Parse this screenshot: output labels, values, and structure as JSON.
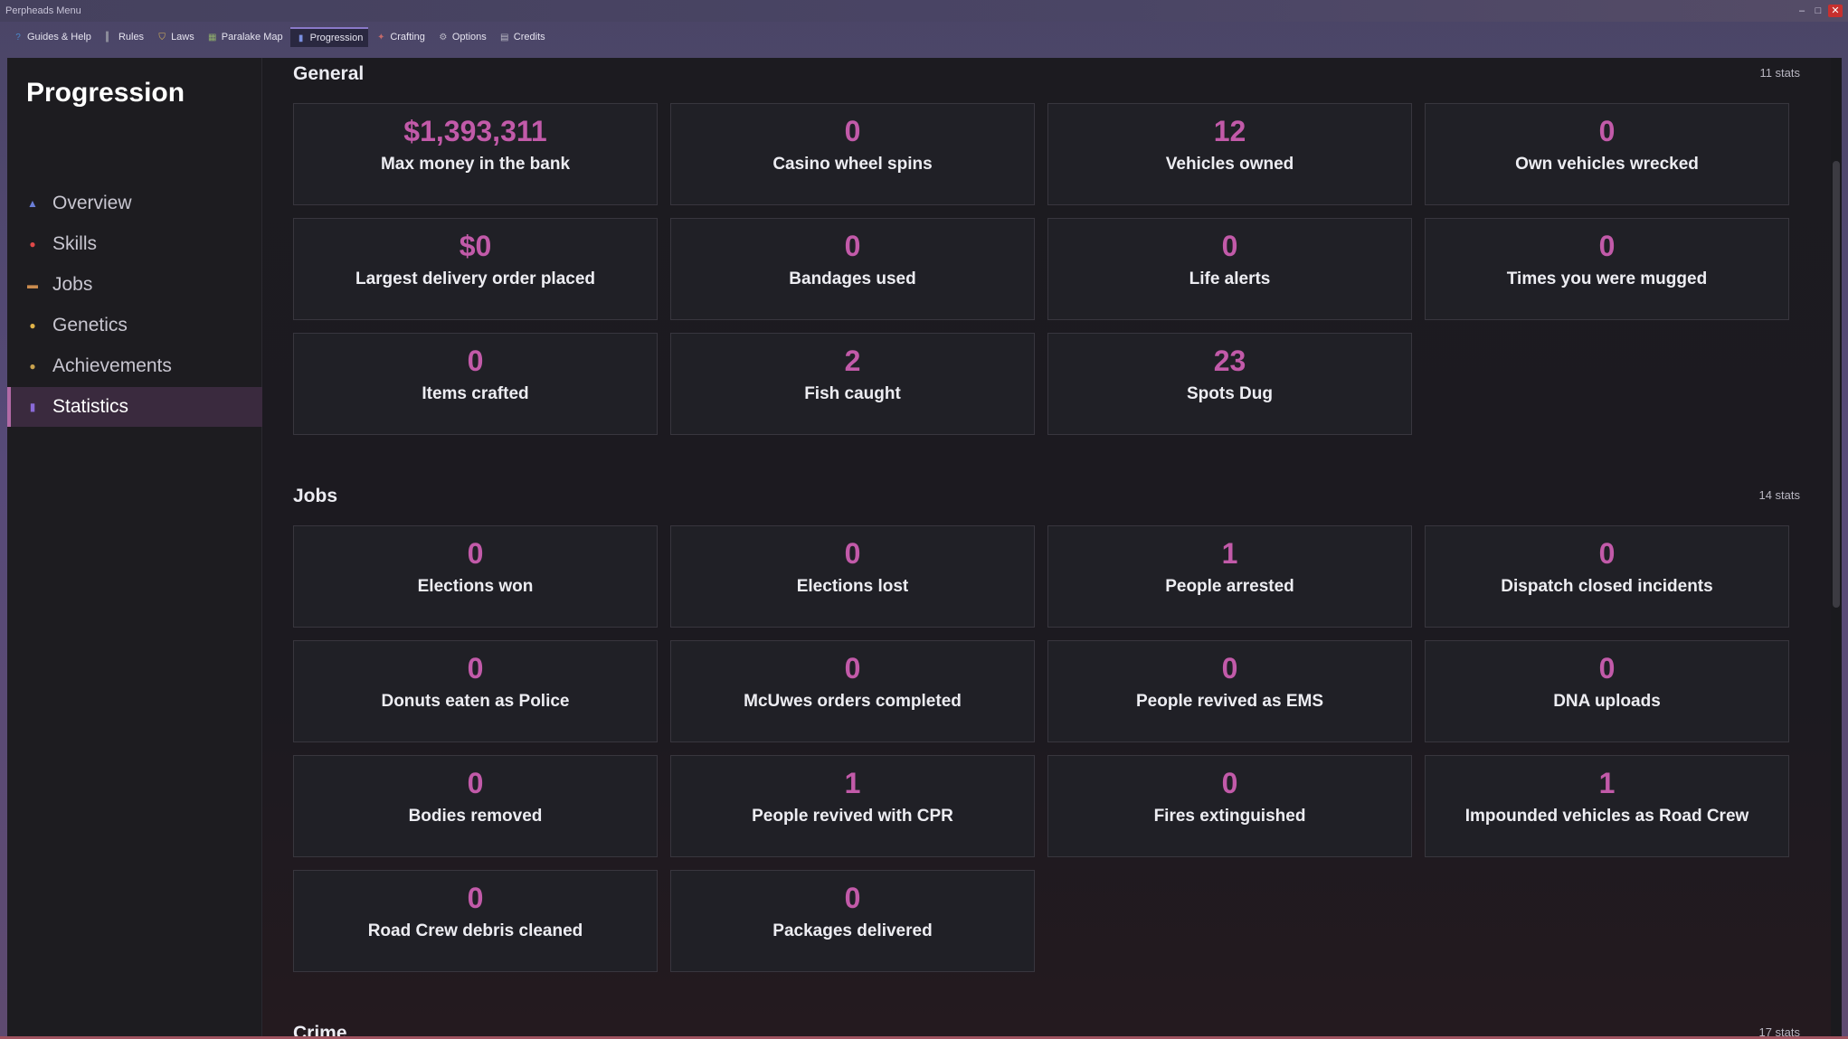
{
  "window": {
    "title": "Perpheads Menu",
    "close_glyph": "✕"
  },
  "menubar": [
    {
      "label": "Guides & Help",
      "icon": "help-icon",
      "glyph": "?",
      "color": "#4a8acc"
    },
    {
      "label": "Rules",
      "icon": "rules-icon",
      "glyph": "▍",
      "color": "#8b8b9a"
    },
    {
      "label": "Laws",
      "icon": "shield-icon",
      "glyph": "⛉",
      "color": "#d9b65a"
    },
    {
      "label": "Paralake Map",
      "icon": "map-icon",
      "glyph": "▦",
      "color": "#8fae6b"
    },
    {
      "label": "Progression",
      "icon": "chart-icon",
      "glyph": "▮",
      "color": "#7a8fe0"
    },
    {
      "label": "Crafting",
      "icon": "crafting-icon",
      "glyph": "✦",
      "color": "#c46a6a"
    },
    {
      "label": "Options",
      "icon": "gear-icon",
      "glyph": "⚙",
      "color": "#b9b9c4"
    },
    {
      "label": "Credits",
      "icon": "credits-icon",
      "glyph": "▤",
      "color": "#b9b9c4"
    }
  ],
  "sidebar": {
    "title": "Progression",
    "items": [
      {
        "label": "Overview",
        "icon": "overview-icon",
        "glyph": "▲",
        "color": "#6a7ed8"
      },
      {
        "label": "Skills",
        "icon": "skills-icon",
        "glyph": "●",
        "color": "#e04848"
      },
      {
        "label": "Jobs",
        "icon": "jobs-icon",
        "glyph": "▬",
        "color": "#c98b4e"
      },
      {
        "label": "Genetics",
        "icon": "genetics-icon",
        "glyph": "●",
        "color": "#e0b348"
      },
      {
        "label": "Achievements",
        "icon": "trophy-icon",
        "glyph": "●",
        "color": "#c9a24e"
      },
      {
        "label": "Statistics",
        "icon": "statistics-icon",
        "glyph": "▮",
        "color": "#8a6ad8"
      }
    ]
  },
  "sections": [
    {
      "title": "General",
      "count": "11 stats",
      "stats": [
        {
          "value": "$1,393,311",
          "label": "Max money in the bank"
        },
        {
          "value": "0",
          "label": "Casino wheel spins"
        },
        {
          "value": "12",
          "label": "Vehicles owned"
        },
        {
          "value": "0",
          "label": "Own vehicles wrecked"
        },
        {
          "value": "$0",
          "label": "Largest delivery order placed"
        },
        {
          "value": "0",
          "label": "Bandages used"
        },
        {
          "value": "0",
          "label": "Life alerts"
        },
        {
          "value": "0",
          "label": "Times you were mugged"
        },
        {
          "value": "0",
          "label": "Items crafted"
        },
        {
          "value": "2",
          "label": "Fish caught"
        },
        {
          "value": "23",
          "label": "Spots Dug"
        }
      ]
    },
    {
      "title": "Jobs",
      "count": "14 stats",
      "stats": [
        {
          "value": "0",
          "label": "Elections won"
        },
        {
          "value": "0",
          "label": "Elections lost"
        },
        {
          "value": "1",
          "label": "People arrested"
        },
        {
          "value": "0",
          "label": "Dispatch closed incidents"
        },
        {
          "value": "0",
          "label": "Donuts eaten as Police"
        },
        {
          "value": "0",
          "label": "McUwes orders completed"
        },
        {
          "value": "0",
          "label": "People revived as EMS"
        },
        {
          "value": "0",
          "label": "DNA uploads"
        },
        {
          "value": "0",
          "label": "Bodies removed"
        },
        {
          "value": "1",
          "label": "People revived with CPR"
        },
        {
          "value": "0",
          "label": "Fires extinguished"
        },
        {
          "value": "1",
          "label": "Impounded vehicles as Road Crew"
        },
        {
          "value": "0",
          "label": "Road Crew debris cleaned"
        },
        {
          "value": "0",
          "label": "Packages delivered"
        }
      ]
    },
    {
      "title": "Crime",
      "count": "17 stats",
      "stats": []
    }
  ],
  "colors": {
    "accent": "#c25aa9",
    "active_nav": "#3a2a3e"
  }
}
